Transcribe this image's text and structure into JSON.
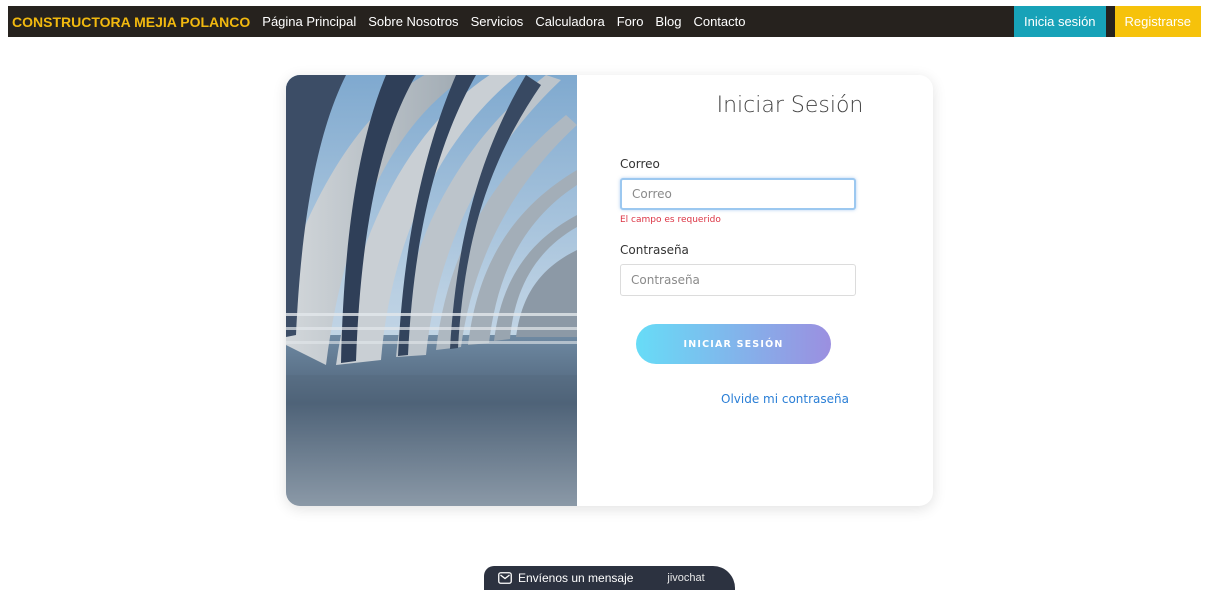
{
  "navbar": {
    "brand": "CONSTRUCTORA MEJIA POLANCO",
    "links": [
      "Página Principal",
      "Sobre Nosotros",
      "Servicios",
      "Calculadora",
      "Foro",
      "Blog",
      "Contacto"
    ],
    "login_button": "Inicia sesión",
    "register_button": "Registrarse"
  },
  "login": {
    "title": "Iniciar Sesión",
    "email_label": "Correo",
    "email_placeholder": "Correo",
    "email_value": "",
    "email_error": "El campo es requerido",
    "password_label": "Contraseña",
    "password_placeholder": "Contraseña",
    "password_value": "",
    "submit": "INICIAR SESIÓN",
    "forgot": "Olvide mi contraseña"
  },
  "chat": {
    "label": "Envíenos un mensaje",
    "brand": "jivochat"
  },
  "colors": {
    "navbar_bg": "#26221e",
    "brand": "#f2b90f",
    "login_button": "#17a2b8",
    "register_button": "#f6c20b",
    "error": "#dc3545",
    "link": "#2b7fd6",
    "chat_bg": "#2c3240"
  },
  "icons": {
    "chat": "envelope-icon"
  }
}
